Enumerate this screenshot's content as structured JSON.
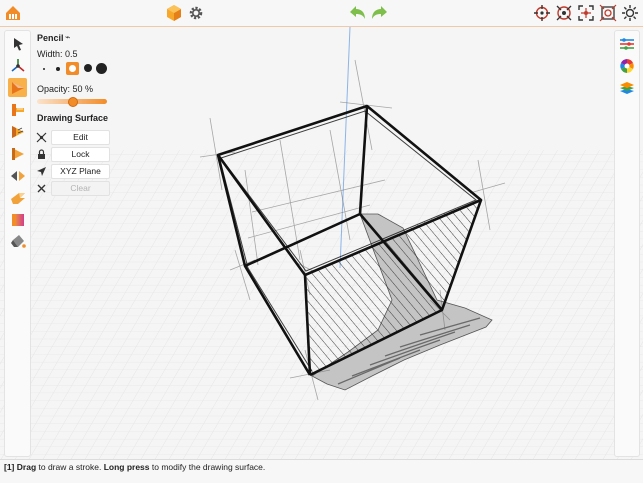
{
  "panel": {
    "tool_name": "Pencil",
    "width_label": "Width: 0.5",
    "opacity_label": "Opacity: 50 %",
    "opacity_value": 0.5,
    "section_title": "Drawing Surface",
    "buttons": {
      "edit": "Edit",
      "lock": "Lock",
      "plane": "XYZ Plane",
      "clear": "Clear"
    },
    "selected_width_index": 2
  },
  "status": {
    "step": "[1]",
    "w1": "Drag",
    "t1": " to draw a stroke. ",
    "w2": "Long press",
    "t2": " to modify the drawing surface."
  },
  "colors": {
    "accent": "#f28c28",
    "undo_redo": "#7dbf4a"
  },
  "icons": {
    "top": [
      "home-icon",
      "cube-icon",
      "settings-gear-icon",
      "undo-icon",
      "redo-icon",
      "target-icon",
      "rotate-view-icon",
      "center-view-icon",
      "fit-view-icon",
      "sun-icon"
    ],
    "left": [
      "select-arrow-icon",
      "axis-gizmo-icon",
      "pencil-tool-icon",
      "ruler-tool-icon",
      "surface-tool-icon",
      "extrude-tool-icon",
      "mirror-tool-icon",
      "hand-tool-icon",
      "color-fill-icon",
      "bucket-icon"
    ],
    "right": [
      "adjust-sliders-icon",
      "color-wheel-icon",
      "layers-icon"
    ]
  }
}
